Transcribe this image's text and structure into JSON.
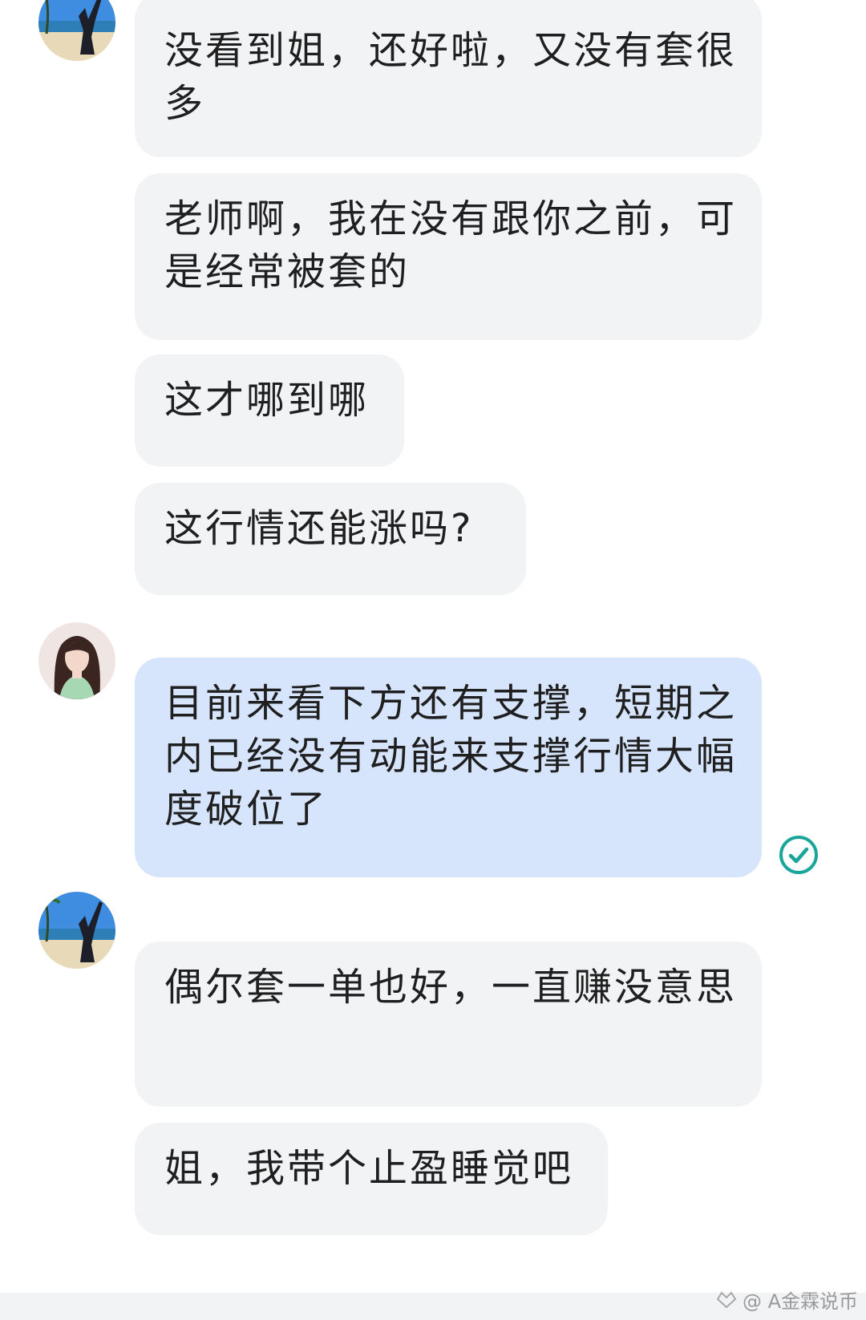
{
  "messages": [
    {
      "sender": "other",
      "text": " 没看到姐，还好啦，又没有套很多"
    },
    {
      "sender": "other",
      "text": "老师啊，我在没有跟你之前，可是经常被套的"
    },
    {
      "sender": "other",
      "text": "这才哪到哪"
    },
    {
      "sender": "other",
      "text": "这行情还能涨吗?"
    },
    {
      "sender": "self",
      "text": "目前来看下方还有支撑，短期之内已经没有动能来支撑行情大幅度破位了",
      "status_icon": "read-check-icon"
    },
    {
      "sender": "other",
      "text": "偶尔套一单也好，一直赚没意思"
    },
    {
      "sender": "other",
      "text": "姐，我带个止盈睡觉吧"
    }
  ],
  "watermark": {
    "text": "@ A金霖说币"
  },
  "colors": {
    "incoming_bubble": "#f2f3f5",
    "outgoing_bubble": "#d6e5fc",
    "read_check": "#1aa59a"
  }
}
